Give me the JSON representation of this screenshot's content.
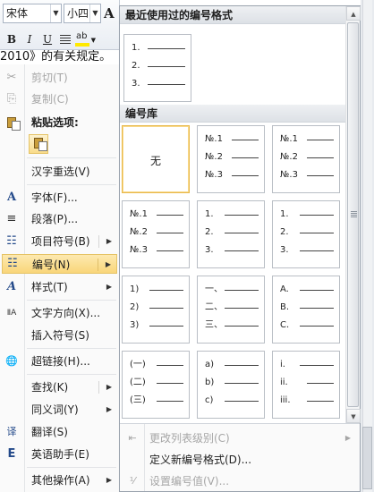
{
  "toolbar": {
    "font_name": "宋体",
    "font_size": "小四",
    "grow_font": "A",
    "bold": "B",
    "italic": "I",
    "underline": "U",
    "highlight": "ab"
  },
  "document": {
    "text": "2010》的有关规定。"
  },
  "context_menu": {
    "items": [
      {
        "label": "剪切(T)",
        "icon": "scissors-icon",
        "glyph": "✂"
      },
      {
        "label": "复制(C)",
        "icon": "copy-icon",
        "glyph": "⎘"
      },
      {
        "label": "粘贴选项:",
        "icon": "paste-icon"
      },
      {
        "label": "汉字重选(V)"
      },
      {
        "label": "字体(F)...",
        "icon": "font-icon",
        "glyph": "A"
      },
      {
        "label": "段落(P)...",
        "icon": "paragraph-icon",
        "glyph": "≡"
      },
      {
        "label": "项目符号(B)",
        "icon": "bullets-icon",
        "glyph": "☷"
      },
      {
        "label": "编号(N)",
        "icon": "numbering-icon",
        "glyph": "☷"
      },
      {
        "label": "样式(T)",
        "icon": "styles-icon",
        "glyph": "A"
      },
      {
        "label": "文字方向(X)...",
        "icon": "text-direction-icon",
        "glyph": "ⅡA"
      },
      {
        "label": "插入符号(S)"
      },
      {
        "label": "超链接(H)...",
        "icon": "hyperlink-icon",
        "glyph": "🌐"
      },
      {
        "label": "查找(K)"
      },
      {
        "label": "同义词(Y)"
      },
      {
        "label": "翻译(S)",
        "icon": "translate-icon",
        "glyph": "译"
      },
      {
        "label": "英语助手(E)",
        "icon": "english-assistant-icon",
        "glyph": "E"
      },
      {
        "label": "其他操作(A)"
      }
    ]
  },
  "numbering_panel": {
    "recent_title": "最近使用过的编号格式",
    "recent": [
      {
        "rows": [
          "1.",
          "2.",
          "3."
        ]
      }
    ],
    "library_title": "编号库",
    "library": [
      {
        "none": "无",
        "rows": []
      },
      {
        "rows": [
          "№.1",
          "№.2",
          "№.3"
        ]
      },
      {
        "rows": [
          "№.1",
          "№.2",
          "№.3"
        ]
      },
      {
        "rows": [
          "№.1",
          "№.2",
          "№.3"
        ]
      },
      {
        "rows": [
          "1.",
          "2.",
          "3."
        ]
      },
      {
        "rows": [
          "1.",
          "2.",
          "3."
        ]
      },
      {
        "rows": [
          "1)",
          "2)",
          "3)"
        ]
      },
      {
        "rows": [
          "一、",
          "二、",
          "三、"
        ]
      },
      {
        "rows": [
          "A.",
          "B.",
          "C."
        ]
      },
      {
        "rows": [
          "(一)",
          "(二)",
          "(三)"
        ]
      },
      {
        "rows": [
          "a)",
          "b)",
          "c)"
        ]
      },
      {
        "rows": [
          "i.",
          "ii.",
          "iii."
        ]
      }
    ],
    "footer": [
      {
        "label": "更改列表级别(C)",
        "icon": "list-level-icon"
      },
      {
        "label": "定义新编号格式(D)..."
      },
      {
        "label": "设置编号值(V)...",
        "icon": "set-value-icon"
      }
    ]
  }
}
